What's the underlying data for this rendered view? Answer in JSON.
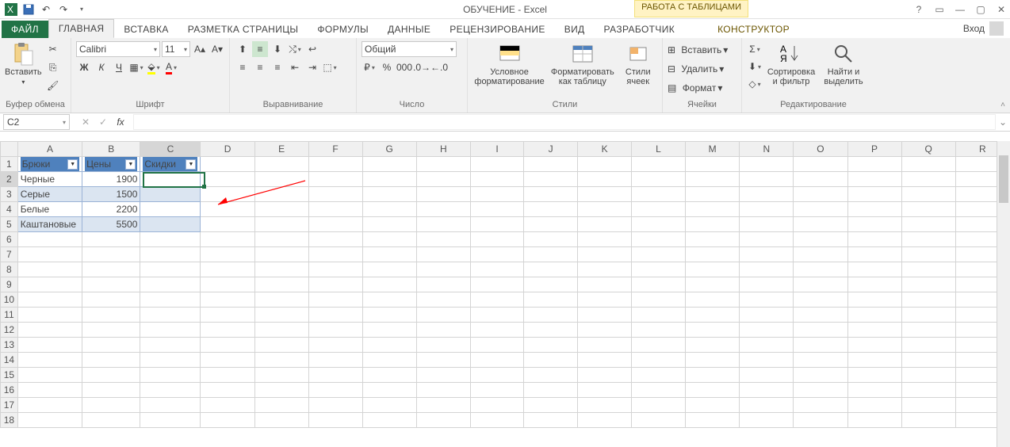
{
  "title": "ОБУЧЕНИЕ - Excel",
  "table_tools": "РАБОТА С ТАБЛИЦАМИ",
  "login": "Вход",
  "tabs": {
    "file": "ФАЙЛ",
    "home": "ГЛАВНАЯ",
    "insert": "ВСТАВКА",
    "layout": "РАЗМЕТКА СТРАНИЦЫ",
    "formulas": "ФОРМУЛЫ",
    "data": "ДАННЫЕ",
    "review": "РЕЦЕНЗИРОВАНИЕ",
    "view": "ВИД",
    "developer": "РАЗРАБОТЧИК",
    "design": "КОНСТРУКТОР"
  },
  "ribbon": {
    "clipboard": {
      "paste": "Вставить",
      "label": "Буфер обмена"
    },
    "font": {
      "name": "Calibri",
      "size": "11",
      "label": "Шрифт"
    },
    "align": {
      "label": "Выравнивание"
    },
    "number": {
      "format": "Общий",
      "label": "Число"
    },
    "styles": {
      "cond": "Условное форматирование",
      "table": "Форматировать как таблицу",
      "cell": "Стили ячеек",
      "label": "Стили"
    },
    "cells": {
      "insert": "Вставить",
      "delete": "Удалить",
      "format": "Формат",
      "label": "Ячейки"
    },
    "editing": {
      "sort": "Сортировка и фильтр",
      "find": "Найти и выделить",
      "label": "Редактирование"
    }
  },
  "namebox": "C2",
  "columns": [
    "A",
    "B",
    "C",
    "D",
    "E",
    "F",
    "G",
    "H",
    "I",
    "J",
    "K",
    "L",
    "M",
    "N",
    "O",
    "P",
    "Q",
    "R"
  ],
  "rows": [
    "1",
    "2",
    "3",
    "4",
    "5",
    "6",
    "7",
    "8",
    "9",
    "10",
    "11",
    "12",
    "13",
    "14",
    "15",
    "16",
    "17",
    "18"
  ],
  "table": {
    "headers": [
      "Брюки",
      "Цены",
      "Скидки"
    ],
    "data": [
      {
        "a": "Черные",
        "b": "1900"
      },
      {
        "a": "Серые",
        "b": "1500"
      },
      {
        "a": "Белые",
        "b": "2200"
      },
      {
        "a": "Каштановые",
        "b": "5500"
      }
    ]
  }
}
